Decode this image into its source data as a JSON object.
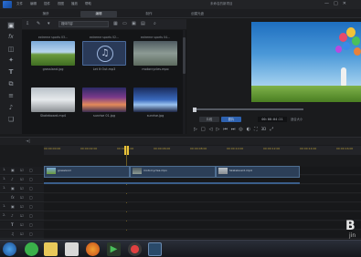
{
  "menubar": {
    "items": [
      "文件",
      "编辑",
      "插件",
      "视图",
      "播放",
      "帮助"
    ],
    "title": "未命名的新项目",
    "window_controls": [
      "—",
      "□",
      "✕"
    ]
  },
  "mode_tabs": [
    {
      "label": "捕获",
      "active": false
    },
    {
      "label": "编辑",
      "active": true
    },
    {
      "label": "制作",
      "active": false
    },
    {
      "label": "创建光盘",
      "active": false
    }
  ],
  "library": {
    "filter_value": "媒体内容",
    "search_icon": "search-icon",
    "items": [
      {
        "top_label": "extreme sports 03...",
        "name": "grassland.jpg",
        "kind": "grass"
      },
      {
        "top_label": "extreme sports 02...",
        "name": "Let It Out.mp3",
        "kind": "music",
        "checked": true
      },
      {
        "top_label": "extreme sports 04...",
        "name": "motorcycles.mpo",
        "kind": "moto"
      },
      {
        "top_label": "",
        "name": "Skateboard.mp4",
        "kind": "skate"
      },
      {
        "top_label": "",
        "name": "sunrise 01.jpg",
        "kind": "sunrise1"
      },
      {
        "top_label": "",
        "name": "sunrise.jpg",
        "kind": "sunrise2"
      }
    ]
  },
  "player": {
    "mode_clip": "片段",
    "mode_movie": "影片",
    "timecode": "00:00:04:21",
    "ratio_label": "适合大小",
    "view_3d": "3D"
  },
  "timeline": {
    "ticks": [
      "00:00:00:00",
      "00:00:02:00",
      "00:00:04:00",
      "00:00:06:00",
      "00:00:08:00",
      "00:00:10:00",
      "00:00:12:00",
      "00:00:14:00",
      "00:00:16:00"
    ],
    "tracks": [
      "1.",
      "1.",
      "1.",
      "",
      "1.",
      "2.",
      "",
      "",
      ""
    ],
    "clips": [
      {
        "label": "grassland"
      },
      {
        "label": "motorcycles.mpo"
      },
      {
        "label": "Skateboard.mp4"
      }
    ]
  },
  "watermark": {
    "big": "B",
    "small": "jin"
  },
  "colors": {
    "accent": "#2e62b0",
    "playhead": "#e8c23a",
    "bg": "#1a1b1d"
  }
}
